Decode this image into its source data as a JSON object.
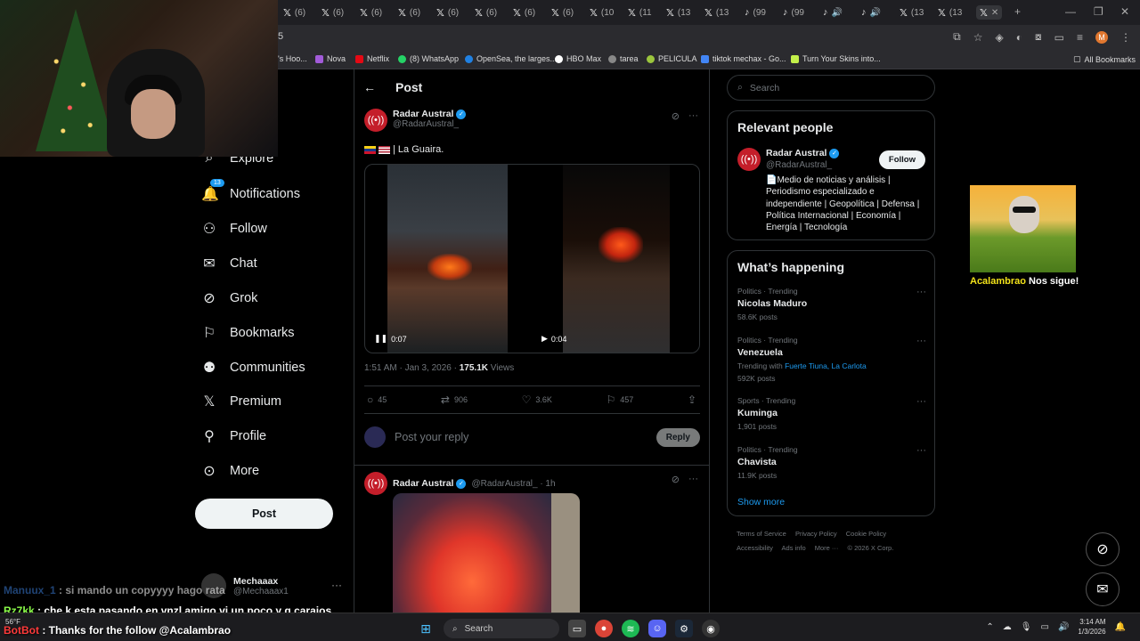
{
  "browser": {
    "tabs": [
      "(6)",
      "(6)",
      "(6)",
      "(6)",
      "(6)",
      "(6)",
      "(6)",
      "(6)",
      "(10",
      "(11",
      "(13",
      "(13",
      "(99",
      "(99",
      "",
      "",
      "(13",
      "(13"
    ],
    "address": "5",
    "bookmarks": [
      "'s Hoo...",
      "Nova",
      "Netflix",
      "(8) WhatsApp",
      "OpenSea, the larges...",
      "HBO Max",
      "tarea",
      "PELICULA",
      "tiktok mechax - Go...",
      "Turn Your Skins into..."
    ],
    "all_bookmarks": "All Bookmarks",
    "profile_initial": "M"
  },
  "nav": {
    "explore": "Explore",
    "notifications": "Notifications",
    "notifications_badge": "13",
    "follow": "Follow",
    "chat": "Chat",
    "grok": "Grok",
    "bookmarks": "Bookmarks",
    "communities": "Communities",
    "premium": "Premium",
    "profile": "Profile",
    "more": "More",
    "post_button": "Post",
    "account_name": "Mechaaax",
    "account_handle": "@Mechaaax1"
  },
  "main": {
    "header": "Post",
    "tweet": {
      "author": "Radar Austral",
      "handle": "@RadarAustral_",
      "text": "| La Guaira.",
      "video1_time": "0:07",
      "video2_time": "0:04",
      "timestamp": "1:51 AM · Jan 3, 2026 · ",
      "views_count": "175.1K",
      "views_label": " Views",
      "replies": "45",
      "reposts": "906",
      "likes": "3.6K",
      "bookmarks": "457"
    },
    "reply_placeholder": "Post your reply",
    "reply_button": "Reply",
    "tweet2": {
      "author": "Radar Austral",
      "handle_time": "@RadarAustral_ · 1h"
    }
  },
  "right": {
    "search_placeholder": "Search",
    "relevant_title": "Relevant people",
    "person": {
      "name": "Radar Austral",
      "handle": "@RadarAustral_",
      "follow": "Follow",
      "bio": "📄Medio de noticias y análisis | Periodismo especializado e independiente | Geopolítica | Defensa | Política Internacional | Economía | Energía | Tecnología"
    },
    "happening_title": "What’s happening",
    "trends": [
      {
        "cat": "Politics · Trending",
        "name": "Nicolas Maduro",
        "posts": "58.6K posts"
      },
      {
        "cat": "Politics · Trending",
        "name": "Venezuela",
        "with_label": "Trending with ",
        "with_links": "Fuerte Tiuna, La Carlota",
        "posts": "592K posts"
      },
      {
        "cat": "Sports · Trending",
        "name": "Kuminga",
        "posts": "1,901 posts"
      },
      {
        "cat": "Politics · Trending",
        "name": "Chavista",
        "posts": "11.9K posts"
      }
    ],
    "show_more": "Show more",
    "footer": [
      "Terms of Service",
      "Privacy Policy",
      "Cookie Policy",
      "Accessibility",
      "Ads info",
      "More ···",
      "© 2026 X Corp."
    ]
  },
  "overlay": {
    "caption_name": "Acalambrao",
    "caption_rest": " Nos sigue!",
    "chat": [
      {
        "user": "Manuux_1",
        "msg": " : si mando un copyyyy hago rata"
      },
      {
        "user": "Rz7kk",
        "msg": " : che k esta pasando en vnzl amigo vi un poco y q carajos"
      },
      {
        "user": "BotBot",
        "msg": " : Thanks for the follow @Acalambrao"
      }
    ]
  },
  "taskbar": {
    "search": "Search",
    "time": "3:14 AM",
    "date": "1/3/2026",
    "weather": "56°F"
  },
  "colors": {
    "accent": "#1d9bf0",
    "brand_red": "#c41e2a"
  }
}
